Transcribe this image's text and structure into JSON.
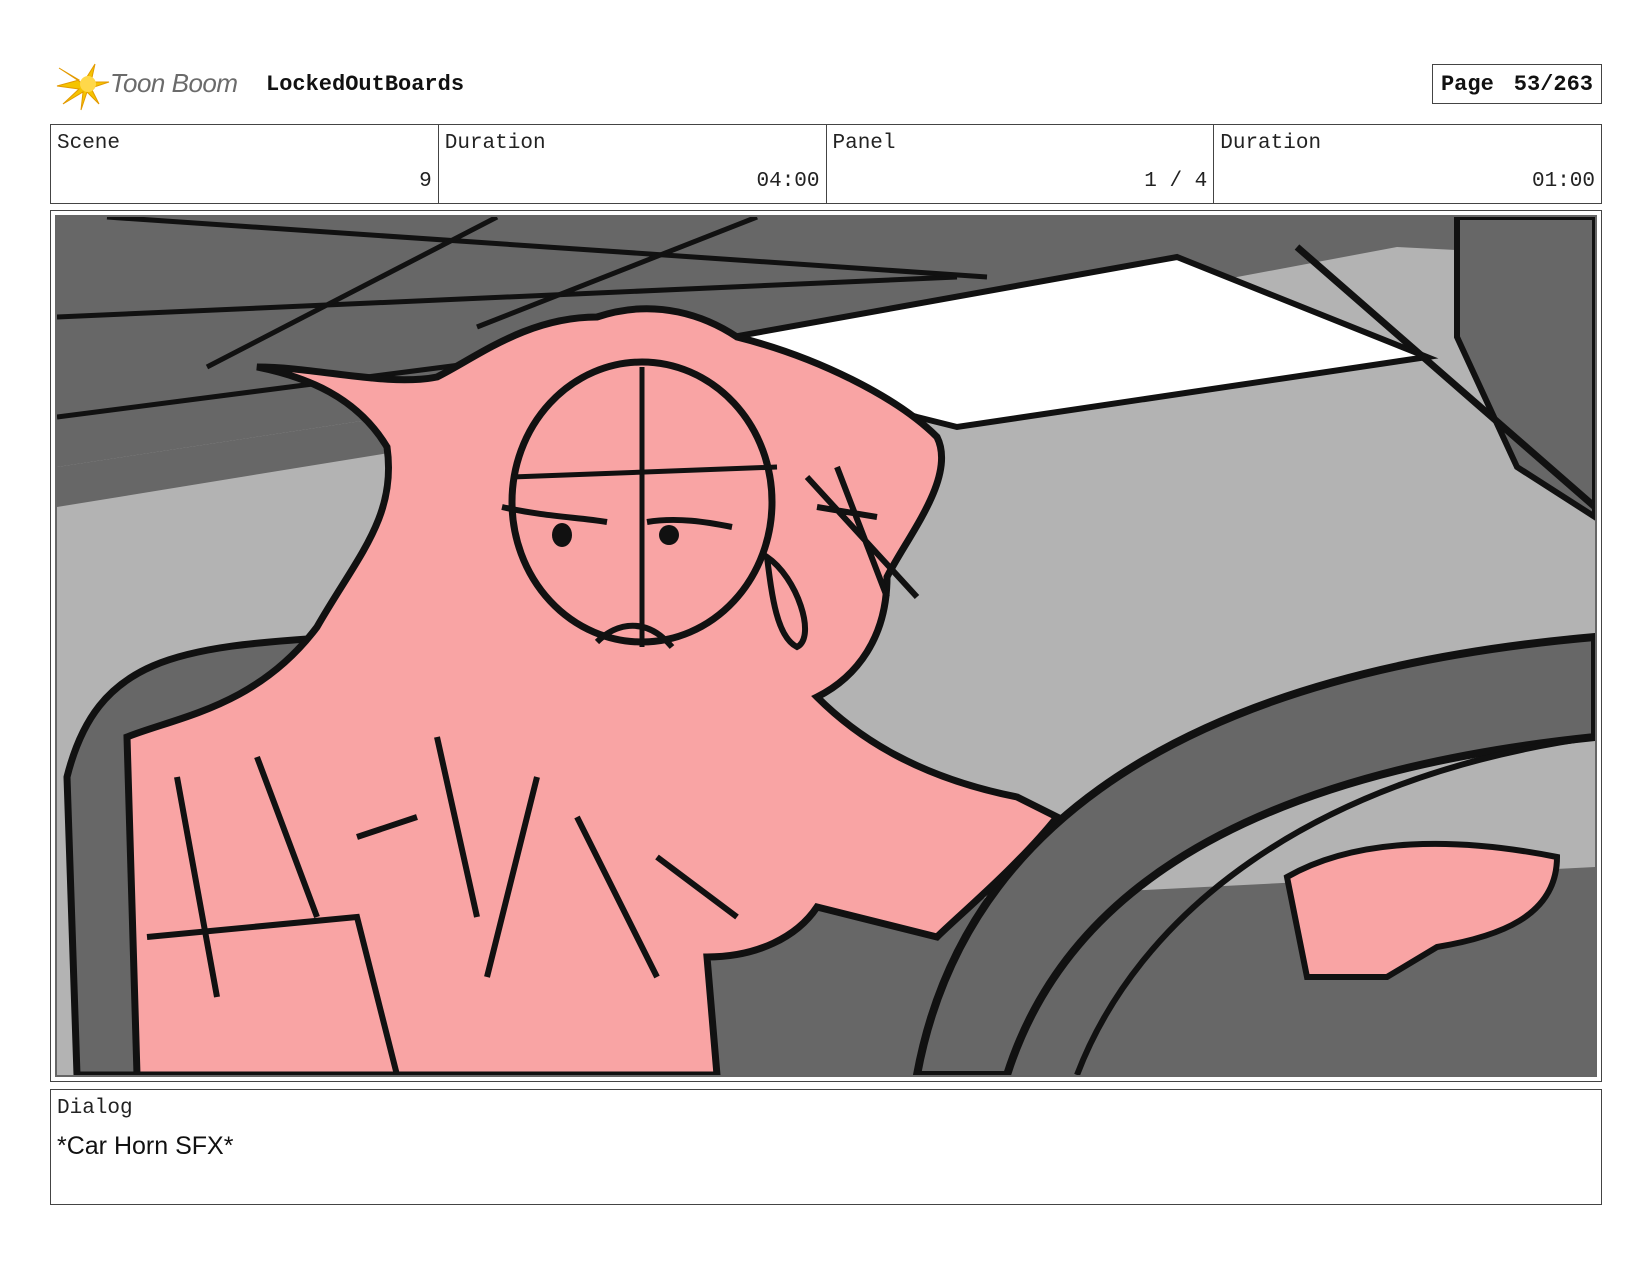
{
  "header": {
    "logo_text": "Toon Boom",
    "project_title": "LockedOutBoards",
    "page_label": "Page",
    "page_value": "53/263"
  },
  "info": {
    "scene_label": "Scene",
    "scene_value": "9",
    "scene_duration_label": "Duration",
    "scene_duration_value": "04:00",
    "panel_label": "Panel",
    "panel_value": "1 / 4",
    "panel_duration_label": "Duration",
    "panel_duration_value": "01:00"
  },
  "dialog": {
    "label": "Dialog",
    "text": "*Car Horn SFX*"
  },
  "colors": {
    "skin": "#f9a4a4",
    "dark_gray": "#676767",
    "mid_gray": "#b3b3b3",
    "logo_yellow": "#f5c400"
  }
}
